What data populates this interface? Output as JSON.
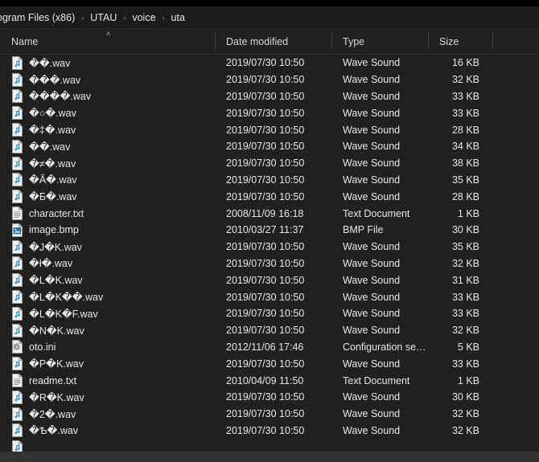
{
  "window": {
    "title": "uta",
    "theme_background": "#202020",
    "accent": "#4aa3e0"
  },
  "breadcrumb": {
    "name": "address-breadcrumb",
    "separator": "›",
    "items": [
      {
        "label": "ogram Files (x86)"
      },
      {
        "label": "UTAU"
      },
      {
        "label": "voice"
      },
      {
        "label": "uta"
      }
    ]
  },
  "columns": [
    {
      "key": "name",
      "label": "Name",
      "sort": "ascending",
      "sort_glyph": "˄"
    },
    {
      "key": "date",
      "label": "Date modified"
    },
    {
      "key": "type",
      "label": "Type"
    },
    {
      "key": "size",
      "label": "Size"
    }
  ],
  "files": [
    {
      "name": "��.wav",
      "date": "2019/07/30 10:50",
      "type": "Wave Sound",
      "size": "16 KB",
      "icon": "wave-sound-icon"
    },
    {
      "name": "���.wav",
      "date": "2019/07/30 10:50",
      "type": "Wave Sound",
      "size": "32 KB",
      "icon": "wave-sound-icon"
    },
    {
      "name": "����.wav",
      "date": "2019/07/30 10:50",
      "type": "Wave Sound",
      "size": "33 KB",
      "icon": "wave-sound-icon"
    },
    {
      "name": "�○�.wav",
      "date": "2019/07/30 10:50",
      "type": "Wave Sound",
      "size": "33 KB",
      "icon": "wave-sound-icon"
    },
    {
      "name": "�‡�.wav",
      "date": "2019/07/30 10:50",
      "type": "Wave Sound",
      "size": "28 KB",
      "icon": "wave-sound-icon"
    },
    {
      "name": "��.wav",
      "date": "2019/07/30 10:50",
      "type": "Wave Sound",
      "size": "34 KB",
      "icon": "wave-sound-icon"
    },
    {
      "name": "�≠�.wav",
      "date": "2019/07/30 10:50",
      "type": "Wave Sound",
      "size": "38 KB",
      "icon": "wave-sound-icon"
    },
    {
      "name": "�Ă�.wav",
      "date": "2019/07/30 10:50",
      "type": "Wave Sound",
      "size": "35 KB",
      "icon": "wave-sound-icon"
    },
    {
      "name": "�Б�.wav",
      "date": "2019/07/30 10:50",
      "type": "Wave Sound",
      "size": "28 KB",
      "icon": "wave-sound-icon"
    },
    {
      "name": "character.txt",
      "date": "2008/11/09 16:18",
      "type": "Text Document",
      "size": "1 KB",
      "icon": "text-document-icon"
    },
    {
      "name": "image.bmp",
      "date": "2010/03/27 11:37",
      "type": "BMP File",
      "size": "30 KB",
      "icon": "bmp-image-icon"
    },
    {
      "name": "�J�K.wav",
      "date": "2019/07/30 10:50",
      "type": "Wave Sound",
      "size": "35 KB",
      "icon": "wave-sound-icon"
    },
    {
      "name": "�ł�.wav",
      "date": "2019/07/30 10:50",
      "type": "Wave Sound",
      "size": "32 KB",
      "icon": "wave-sound-icon"
    },
    {
      "name": "�L�K.wav",
      "date": "2019/07/30 10:50",
      "type": "Wave Sound",
      "size": "31 KB",
      "icon": "wave-sound-icon"
    },
    {
      "name": "�L�K��.wav",
      "date": "2019/07/30 10:50",
      "type": "Wave Sound",
      "size": "33 KB",
      "icon": "wave-sound-icon"
    },
    {
      "name": "�L�K�F.wav",
      "date": "2019/07/30 10:50",
      "type": "Wave Sound",
      "size": "33 KB",
      "icon": "wave-sound-icon"
    },
    {
      "name": "�N�K.wav",
      "date": "2019/07/30 10:50",
      "type": "Wave Sound",
      "size": "32 KB",
      "icon": "wave-sound-icon"
    },
    {
      "name": "oto.ini",
      "date": "2012/11/06 17:46",
      "type": "Configuration sett...",
      "size": "5 KB",
      "icon": "configuration-settings-icon"
    },
    {
      "name": "�P�K.wav",
      "date": "2019/07/30 10:50",
      "type": "Wave Sound",
      "size": "33 KB",
      "icon": "wave-sound-icon"
    },
    {
      "name": "readme.txt",
      "date": "2010/04/09 11:50",
      "type": "Text Document",
      "size": "1 KB",
      "icon": "text-document-icon"
    },
    {
      "name": "�R�K.wav",
      "date": "2019/07/30 10:50",
      "type": "Wave Sound",
      "size": "30 KB",
      "icon": "wave-sound-icon"
    },
    {
      "name": "�2�.wav",
      "date": "2019/07/30 10:50",
      "type": "Wave Sound",
      "size": "32 KB",
      "icon": "wave-sound-icon"
    },
    {
      "name": "�Ѣ�.wav",
      "date": "2019/07/30 10:50",
      "type": "Wave Sound",
      "size": "32 KB",
      "icon": "wave-sound-icon"
    },
    {
      "name": "",
      "date": "",
      "type": "",
      "size": "",
      "icon": "wave-sound-icon"
    }
  ]
}
